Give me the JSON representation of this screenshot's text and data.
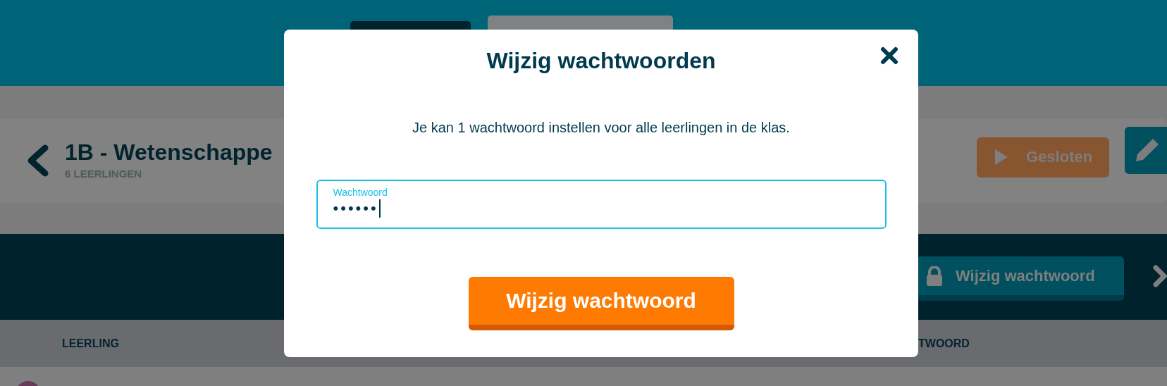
{
  "class_header": {
    "title": "1B - Wetenschappe",
    "subtitle": "6 LEERLINGEN",
    "status_button": "Gesloten"
  },
  "toolbar": {
    "button": "Wijzig wachtwoord"
  },
  "table": {
    "columns": [
      "LEERLING",
      "TWOORD"
    ]
  },
  "dialog": {
    "title": "Wijzig wachtwoorden",
    "message": "Je kan 1 wachtwoord instellen voor alle leerlingen in de klas.",
    "field": {
      "label": "Wachtwoord",
      "value": "••••••",
      "focused": true
    },
    "button": "Wijzig wachtwoord"
  }
}
